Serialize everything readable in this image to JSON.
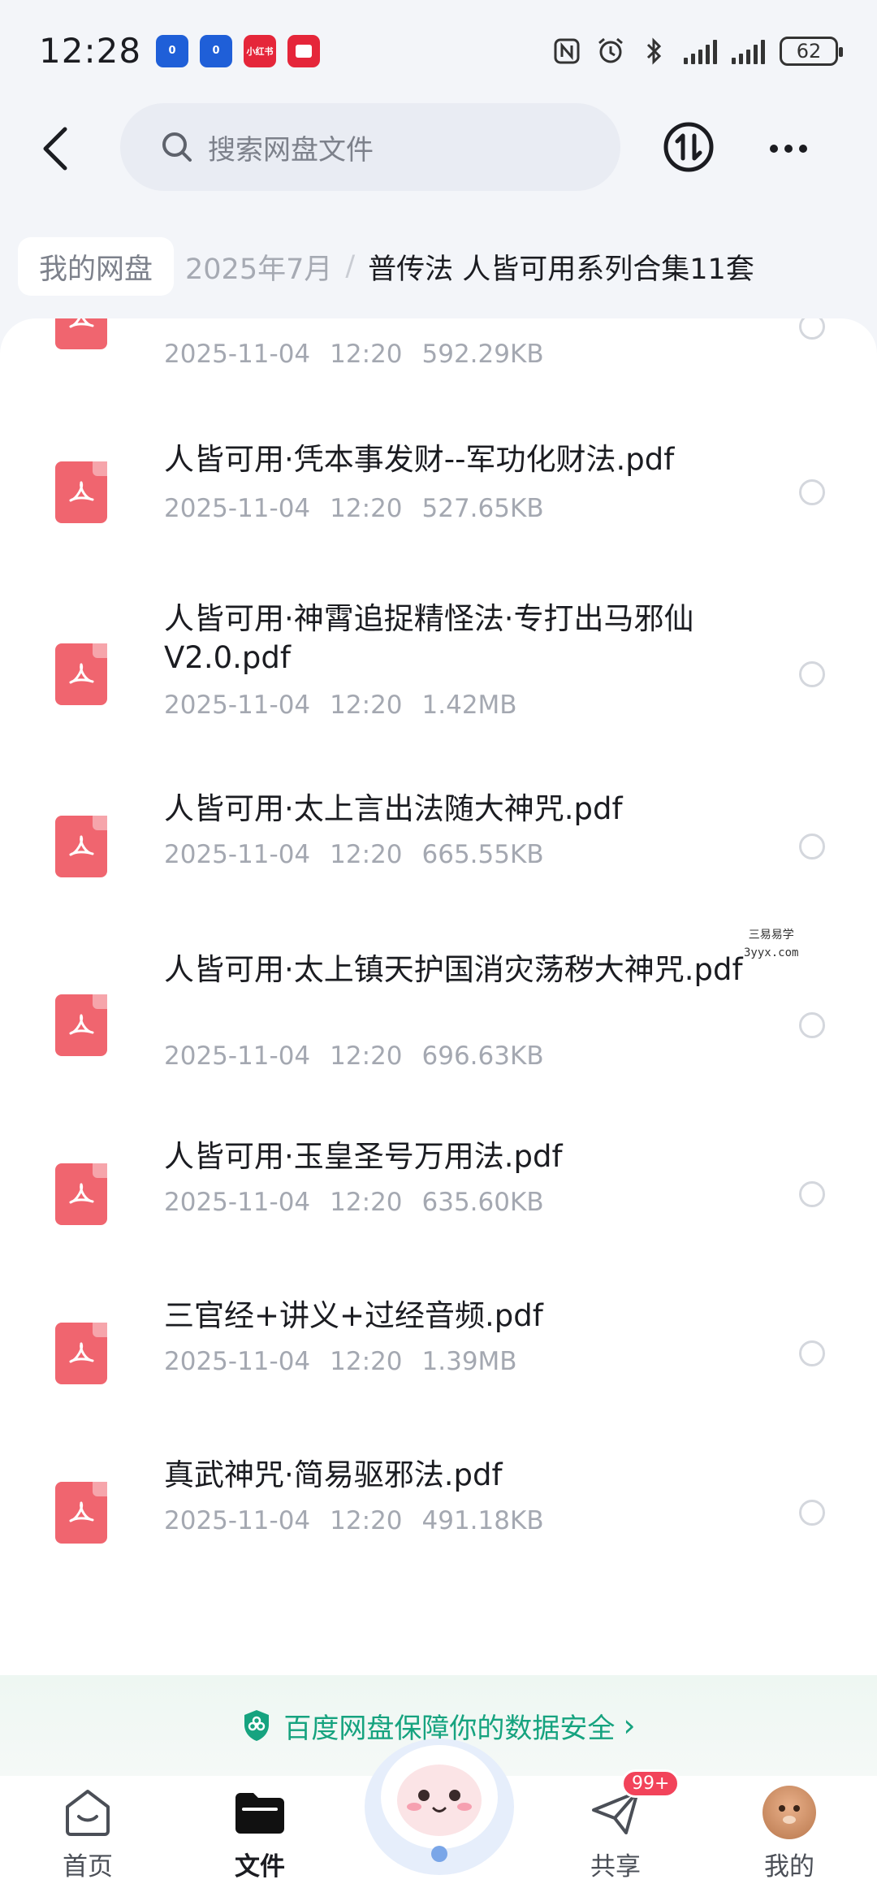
{
  "status_bar": {
    "time": "12:28",
    "notifications": [
      {
        "icon": "app-blue-icon",
        "text": "0"
      },
      {
        "icon": "app-blue-icon",
        "text": "0"
      },
      {
        "icon": "xiaohongshu-icon",
        "text": "小红书"
      },
      {
        "icon": "red-app-icon",
        "text": ""
      }
    ],
    "battery": "62"
  },
  "header": {
    "search_placeholder": "搜索网盘文件"
  },
  "breadcrumb": {
    "root": "我的网盘",
    "parent": "2025年7月",
    "separator": "/",
    "current": "普传法 人皆可用系列合集11套"
  },
  "files": [
    {
      "name": "",
      "date": "2025-11-04",
      "time": "12:20",
      "size": "592.29KB"
    },
    {
      "name": "人皆可用·凭本事发财--军功化财法.pdf",
      "date": "2025-11-04",
      "time": "12:20",
      "size": "527.65KB"
    },
    {
      "name": "人皆可用·神霄追捉精怪法·专打出马邪仙V2.0.pdf",
      "date": "2025-11-04",
      "time": "12:20",
      "size": "1.42MB"
    },
    {
      "name": "人皆可用·太上言出法随大神咒.pdf",
      "date": "2025-11-04",
      "time": "12:20",
      "size": "665.55KB"
    },
    {
      "name": "人皆可用·太上镇天护国消灾荡秽大神咒.pdf",
      "date": "2025-11-04",
      "time": "12:20",
      "size": "696.63KB"
    },
    {
      "name": "人皆可用·玉皇圣号万用法.pdf",
      "date": "2025-11-04",
      "time": "12:20",
      "size": "635.60KB"
    },
    {
      "name": "三官经+讲义+过经音频.pdf",
      "date": "2025-11-04",
      "time": "12:20",
      "size": "1.39MB"
    },
    {
      "name": "真武神咒·简易驱邪法.pdf",
      "date": "2025-11-04",
      "time": "12:20",
      "size": "491.18KB"
    }
  ],
  "watermark": {
    "line1": "三易易学",
    "line2": "3yyx.com"
  },
  "security_banner": {
    "text": "百度网盘保障你的数据安全",
    "chevron": "›"
  },
  "bottom_nav": {
    "home": "首页",
    "files": "文件",
    "share": "共享",
    "share_badge": "99+",
    "mine": "我的"
  },
  "colors": {
    "accent_green": "#16a37f",
    "pdf_red": "#f0656f",
    "badge_red": "#f2435a"
  }
}
